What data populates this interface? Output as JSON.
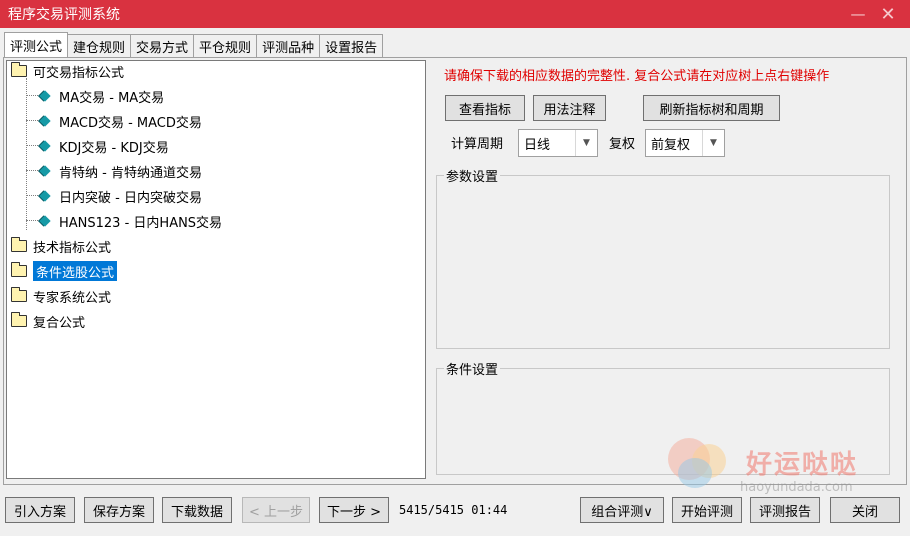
{
  "window": {
    "title": "程序交易评测系统",
    "minimize": "—",
    "close": "✕"
  },
  "tabs": [
    "评测公式",
    "建仓规则",
    "交易方式",
    "平仓规则",
    "评测品种",
    "设置报告"
  ],
  "tree": {
    "root_folder": "可交易指标公式",
    "leaves": [
      "MA交易 - MA交易",
      "MACD交易 - MACD交易",
      "KDJ交易 - KDJ交易",
      "肯特纳 - 肯特纳通道交易",
      "日内突破 - 日内突破交易",
      "HANS123 - 日内HANS交易"
    ],
    "folders": [
      "技术指标公式",
      "条件选股公式",
      "专家系统公式",
      "复合公式"
    ],
    "selected": "条件选股公式"
  },
  "right": {
    "warning": "请确保下载的相应数据的完整性. 复合公式请在对应树上点右键操作",
    "buttons": {
      "view": "查看指标",
      "usage": "用法注释",
      "refresh": "刷新指标树和周期"
    },
    "period_label": "计算周期",
    "period_value": "日线",
    "adjust_label": "复权",
    "adjust_value": "前复权",
    "params_group": "参数设置",
    "cond_group": "条件设置"
  },
  "bottom": {
    "import": "引入方案",
    "save": "保存方案",
    "download": "下载数据",
    "prev": "< 上一步",
    "next": "下一步 >",
    "status": "5415/5415 01:44",
    "combo_eval": "组合评测∨",
    "start": "开始评测",
    "report": "评测报告",
    "close": "关闭"
  },
  "watermark": {
    "text": "好运哒哒",
    "url": "haoyundada.com"
  },
  "colors": {
    "titlebar": "#d93240",
    "selection": "#0078d7",
    "warning": "#e00000",
    "leaf_icon": "#169aa6"
  }
}
